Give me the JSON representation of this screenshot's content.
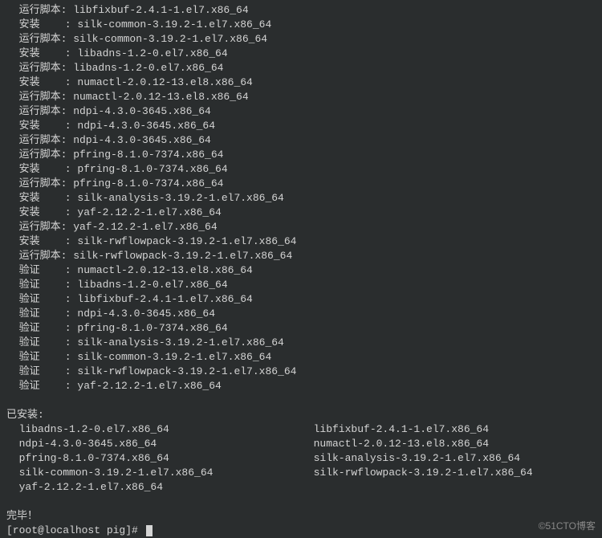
{
  "lines": [
    {
      "action": "运行脚本",
      "sep": ": ",
      "pkg": "libfixbuf-2.4.1-1.el7.x86_64"
    },
    {
      "action": "安装",
      "sep": "    : ",
      "pkg": "silk-common-3.19.2-1.el7.x86_64"
    },
    {
      "action": "运行脚本",
      "sep": ": ",
      "pkg": "silk-common-3.19.2-1.el7.x86_64"
    },
    {
      "action": "安装",
      "sep": "    : ",
      "pkg": "libadns-1.2-0.el7.x86_64"
    },
    {
      "action": "运行脚本",
      "sep": ": ",
      "pkg": "libadns-1.2-0.el7.x86_64"
    },
    {
      "action": "安装",
      "sep": "    : ",
      "pkg": "numactl-2.0.12-13.el8.x86_64"
    },
    {
      "action": "运行脚本",
      "sep": ": ",
      "pkg": "numactl-2.0.12-13.el8.x86_64"
    },
    {
      "action": "运行脚本",
      "sep": ": ",
      "pkg": "ndpi-4.3.0-3645.x86_64"
    },
    {
      "action": "安装",
      "sep": "    : ",
      "pkg": "ndpi-4.3.0-3645.x86_64"
    },
    {
      "action": "运行脚本",
      "sep": ": ",
      "pkg": "ndpi-4.3.0-3645.x86_64"
    },
    {
      "action": "运行脚本",
      "sep": ": ",
      "pkg": "pfring-8.1.0-7374.x86_64"
    },
    {
      "action": "安装",
      "sep": "    : ",
      "pkg": "pfring-8.1.0-7374.x86_64"
    },
    {
      "action": "运行脚本",
      "sep": ": ",
      "pkg": "pfring-8.1.0-7374.x86_64"
    },
    {
      "action": "安装",
      "sep": "    : ",
      "pkg": "silk-analysis-3.19.2-1.el7.x86_64"
    },
    {
      "action": "安装",
      "sep": "    : ",
      "pkg": "yaf-2.12.2-1.el7.x86_64"
    },
    {
      "action": "运行脚本",
      "sep": ": ",
      "pkg": "yaf-2.12.2-1.el7.x86_64"
    },
    {
      "action": "安装",
      "sep": "    : ",
      "pkg": "silk-rwflowpack-3.19.2-1.el7.x86_64"
    },
    {
      "action": "运行脚本",
      "sep": ": ",
      "pkg": "silk-rwflowpack-3.19.2-1.el7.x86_64"
    },
    {
      "action": "验证",
      "sep": "    : ",
      "pkg": "numactl-2.0.12-13.el8.x86_64"
    },
    {
      "action": "验证",
      "sep": "    : ",
      "pkg": "libadns-1.2-0.el7.x86_64"
    },
    {
      "action": "验证",
      "sep": "    : ",
      "pkg": "libfixbuf-2.4.1-1.el7.x86_64"
    },
    {
      "action": "验证",
      "sep": "    : ",
      "pkg": "ndpi-4.3.0-3645.x86_64"
    },
    {
      "action": "验证",
      "sep": "    : ",
      "pkg": "pfring-8.1.0-7374.x86_64"
    },
    {
      "action": "验证",
      "sep": "    : ",
      "pkg": "silk-analysis-3.19.2-1.el7.x86_64"
    },
    {
      "action": "验证",
      "sep": "    : ",
      "pkg": "silk-common-3.19.2-1.el7.x86_64"
    },
    {
      "action": "验证",
      "sep": "    : ",
      "pkg": "silk-rwflowpack-3.19.2-1.el7.x86_64"
    },
    {
      "action": "验证",
      "sep": "    : ",
      "pkg": "yaf-2.12.2-1.el7.x86_64"
    }
  ],
  "installed_header": "已安装:",
  "installed": [
    "libadns-1.2-0.el7.x86_64",
    "libfixbuf-2.4.1-1.el7.x86_64",
    "ndpi-4.3.0-3645.x86_64",
    "numactl-2.0.12-13.el8.x86_64",
    "pfring-8.1.0-7374.x86_64",
    "silk-analysis-3.19.2-1.el7.x86_64",
    "silk-common-3.19.2-1.el7.x86_64",
    "silk-rwflowpack-3.19.2-1.el7.x86_64",
    "yaf-2.12.2-1.el7.x86_64"
  ],
  "done": "完毕！",
  "prompt": "[root@localhost pig]# ",
  "watermark": "©51CTO博客"
}
